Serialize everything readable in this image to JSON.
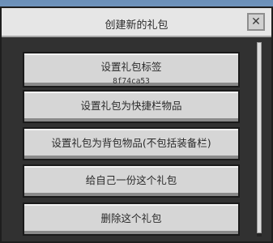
{
  "dialog": {
    "title": "创建新的礼包",
    "close_glyph": "✕"
  },
  "buttons": [
    {
      "label": "设置礼包标签",
      "sub": "8f74ca53"
    },
    {
      "label": "设置礼包为快捷栏物品"
    },
    {
      "label": "设置礼包为背包物品(不包括装备栏)"
    },
    {
      "label": "给自己一份这个礼包"
    },
    {
      "label": "删除这个礼包"
    }
  ],
  "icons": {
    "close": "close-icon"
  }
}
